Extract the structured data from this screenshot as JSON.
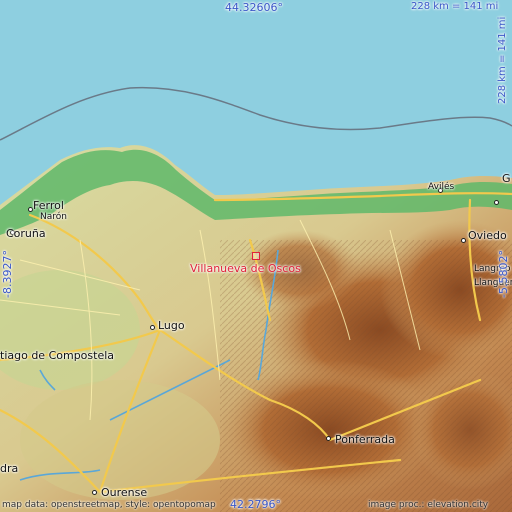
{
  "colors": {
    "sea": "#8ecfe0",
    "land_low": "#cbd79e",
    "coast_green": "#4caf63",
    "mountain": "#b06a35",
    "roads": "#f2c94c",
    "coordinate_text": "#3a57c8",
    "featured_place": "#e0223a"
  },
  "coordinates": {
    "top_latitude": "44.32606°",
    "bottom_latitude": "42.2796°",
    "left_longitude": "-8.3927°",
    "right_longitude": "-5.5802°"
  },
  "scale": {
    "top": "228 km = 141 mi",
    "right": "228 km = 141 mi"
  },
  "featured_place": {
    "name": "Villanueva de Oscos"
  },
  "places": [
    {
      "name": "Ferrol"
    },
    {
      "name": "Narón"
    },
    {
      "name": "Coruña"
    },
    {
      "name": "Lugo"
    },
    {
      "name": "tiago de Compostela"
    },
    {
      "name": "Ourense"
    },
    {
      "name": "Ponferrada"
    },
    {
      "name": "Oviedo"
    },
    {
      "name": "Avilés"
    },
    {
      "name": "Langreo"
    },
    {
      "name": "Llanguera"
    },
    {
      "name": "dra"
    },
    {
      "name": "G"
    }
  ],
  "credits": {
    "left": "map data: openstreetmap, style: opentopomap",
    "right": "image proc.: elevation.city"
  }
}
